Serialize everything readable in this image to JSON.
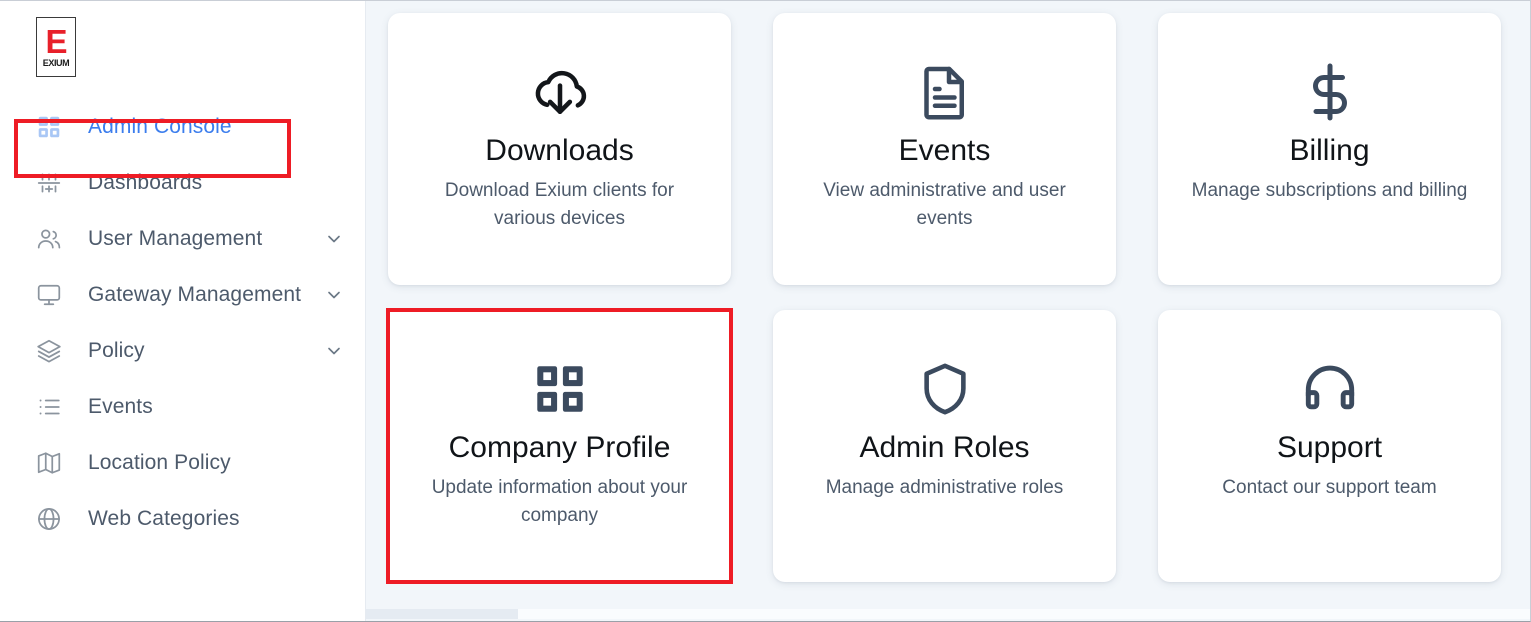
{
  "brand": {
    "logo_letter": "E",
    "logo_word": "EXIUM",
    "accent_color": "#e8202a",
    "link_color": "#3b7ded",
    "highlight_color": "#ee1c25"
  },
  "sidebar": {
    "items": [
      {
        "label": "Admin Console",
        "icon": "grid-icon",
        "active": true,
        "expandable": false,
        "highlighted": true
      },
      {
        "label": "Dashboards",
        "icon": "sliders-icon",
        "active": false,
        "expandable": false,
        "highlighted": false
      },
      {
        "label": "User Management",
        "icon": "users-icon",
        "active": false,
        "expandable": true,
        "highlighted": false
      },
      {
        "label": "Gateway Management",
        "icon": "monitor-icon",
        "active": false,
        "expandable": true,
        "highlighted": false
      },
      {
        "label": "Policy",
        "icon": "layers-icon",
        "active": false,
        "expandable": true,
        "highlighted": false
      },
      {
        "label": "Events",
        "icon": "list-icon",
        "active": false,
        "expandable": false,
        "highlighted": false
      },
      {
        "label": "Location Policy",
        "icon": "map-icon",
        "active": false,
        "expandable": false,
        "highlighted": false
      },
      {
        "label": "Web Categories",
        "icon": "globe-icon",
        "active": false,
        "expandable": false,
        "highlighted": false
      }
    ]
  },
  "main": {
    "cards": [
      {
        "title": "Downloads",
        "desc": "Download Exium clients for various devices",
        "icon": "cloud-download-icon",
        "highlighted": false
      },
      {
        "title": "Events",
        "desc": "View administrative and user events",
        "icon": "document-lines-icon",
        "highlighted": false
      },
      {
        "title": "Billing",
        "desc": "Manage subscriptions and billing",
        "icon": "dollar-sign-icon",
        "highlighted": false
      },
      {
        "title": "Company Profile",
        "desc": "Update information about your company",
        "icon": "grid-squares-icon",
        "highlighted": true
      },
      {
        "title": "Admin Roles",
        "desc": "Manage administrative roles",
        "icon": "shield-icon",
        "highlighted": false
      },
      {
        "title": "Support",
        "desc": "Contact our support team",
        "icon": "headset-icon",
        "highlighted": false
      }
    ]
  }
}
